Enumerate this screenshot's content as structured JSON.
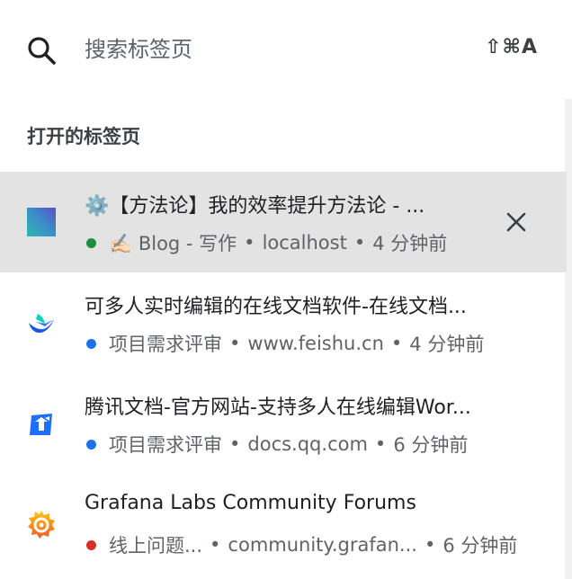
{
  "search": {
    "placeholder": "搜索标签页",
    "shortcut": "⇧⌘A"
  },
  "section_title": "打开的标签页",
  "colors": {
    "selected_bg": "#e3e3e3",
    "group_green": "#1e8e3e",
    "group_blue": "#1a73e8",
    "group_red": "#d93025"
  },
  "tabs": [
    {
      "title": "⚙️【方法论】我的效率提升方法论 - ...",
      "group": "✍🏻 Blog - 写作",
      "group_color": "#1e8e3e",
      "domain": "localhost",
      "time": "4 分钟前",
      "favicon": "gradient-square-icon",
      "selected": true
    },
    {
      "title": "可多人实时编辑的在线文档软件-在线文档...",
      "group": "项目需求评审",
      "group_color": "#1a73e8",
      "domain": "www.feishu.cn",
      "time": "4 分钟前",
      "favicon": "feishu-icon",
      "selected": false
    },
    {
      "title": "腾讯文档-官方网站-支持多人在线编辑Wor...",
      "group": "项目需求评审",
      "group_color": "#1a73e8",
      "domain": "docs.qq.com",
      "time": "6 分钟前",
      "favicon": "tencent-docs-icon",
      "selected": false
    },
    {
      "title": "Grafana Labs Community Forums",
      "group": "线上问题...",
      "group_color": "#d93025",
      "domain": "community.grafan...",
      "time": "6 分钟前",
      "favicon": "grafana-icon",
      "selected": false
    }
  ]
}
